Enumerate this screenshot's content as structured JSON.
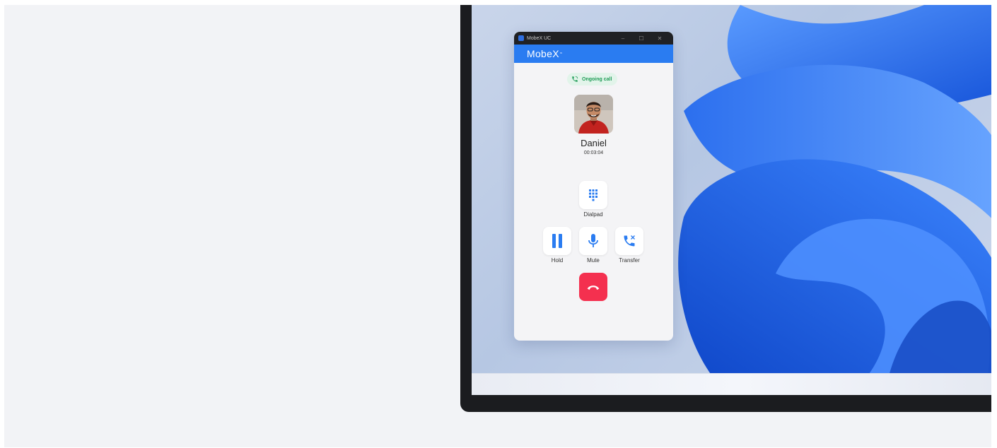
{
  "window": {
    "title": "MobeX UC",
    "minimize_glyph": "–",
    "maximize_glyph": "☐",
    "close_glyph": "✕"
  },
  "app": {
    "brand": "MobeX",
    "brand_suffix": "≈"
  },
  "call": {
    "status": "Ongoing call",
    "contact_name": "Daniel",
    "duration": "00:03:04"
  },
  "controls": {
    "dialpad_label": "Dialpad",
    "hold_label": "Hold",
    "mute_label": "Mute",
    "transfer_label": "Transfer"
  },
  "colors": {
    "brand_blue": "#2a7cf1",
    "status_green": "#1d9b55",
    "end_call_red": "#f4304f",
    "icon_blue": "#2a7cf1"
  },
  "icons": [
    "phone-icon",
    "dialpad-icon",
    "pause-icon",
    "microphone-icon",
    "phone-transfer-icon",
    "hang-up-icon"
  ]
}
